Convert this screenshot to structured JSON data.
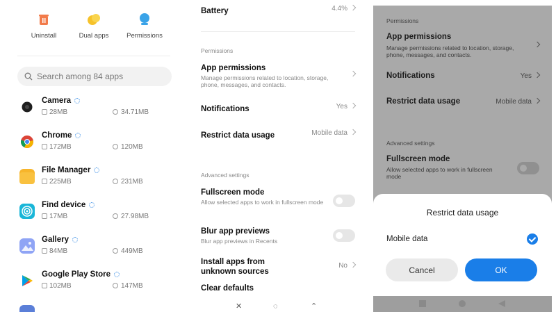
{
  "app_manager": {
    "actions": [
      {
        "label": "Uninstall",
        "icon": "trash-icon"
      },
      {
        "label": "Dual apps",
        "icon": "dual-apps-icon"
      },
      {
        "label": "Permissions",
        "icon": "permissions-icon"
      }
    ],
    "search": {
      "placeholder": "Search among 84 apps"
    },
    "apps": [
      {
        "name": "Camera",
        "size": "28MB",
        "cache": "34.71MB",
        "icon_color": "#1e1e1e"
      },
      {
        "name": "Chrome",
        "size": "172MB",
        "cache": "120MB",
        "icon_color": "#db4437"
      },
      {
        "name": "File Manager",
        "size": "225MB",
        "cache": "231MB",
        "icon_color": "#f7b52b"
      },
      {
        "name": "Find device",
        "size": "17MB",
        "cache": "27.98MB",
        "icon_color": "#19b6d8"
      },
      {
        "name": "Gallery",
        "size": "84MB",
        "cache": "449MB",
        "icon_color": "#8fa4f5"
      },
      {
        "name": "Google Play Store",
        "size": "102MB",
        "cache": "147MB",
        "icon_color": "#34a853"
      }
    ]
  },
  "app_info": {
    "battery": {
      "label": "Battery",
      "value": "4.4%"
    },
    "permissions_section": "Permissions",
    "app_permissions": {
      "title": "App permissions",
      "subtitle": "Manage permissions related to location, storage, phone, messages, and contacts."
    },
    "notifications": {
      "title": "Notifications",
      "value": "Yes"
    },
    "restrict": {
      "title": "Restrict data usage",
      "value": "Mobile data"
    },
    "advanced_section": "Advanced settings",
    "fullscreen": {
      "title": "Fullscreen mode",
      "subtitle": "Allow selected apps to work in fullscreen mode"
    },
    "blur": {
      "title": "Blur app previews",
      "subtitle": "Blur app previews in Recents"
    },
    "unknown": {
      "title": "Install apps from unknown sources",
      "value": "No"
    },
    "clear_defaults": {
      "title": "Clear defaults"
    }
  },
  "dialog": {
    "background": {
      "permissions_section": "Permissions",
      "app_permissions": {
        "title": "App permissions",
        "subtitle": "Manage permissions related to location, storage, phone, messages, and contacts."
      },
      "notifications": {
        "title": "Notifications",
        "value": "Yes"
      },
      "restrict": {
        "title": "Restrict data usage",
        "value": "Mobile data"
      },
      "advanced_section": "Advanced settings",
      "fullscreen": {
        "title": "Fullscreen mode",
        "subtitle": "Allow selected apps to work in fullscreen mode"
      }
    },
    "title": "Restrict data usage",
    "option": {
      "label": "Mobile data",
      "checked": true
    },
    "cancel_label": "Cancel",
    "ok_label": "OK",
    "accent": "#1a7ee8"
  }
}
